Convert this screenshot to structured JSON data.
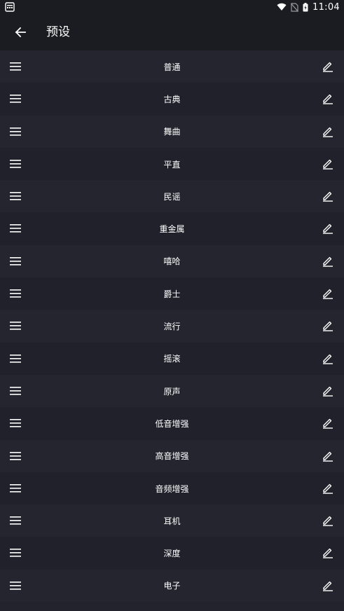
{
  "status_bar": {
    "time": "11:04",
    "icons": [
      "app-notification-icon",
      "wifi-icon",
      "no-sim-icon",
      "battery-charging-icon"
    ]
  },
  "app_bar": {
    "title": "预设",
    "back_icon": "arrow-back-icon"
  },
  "presets": [
    {
      "label": "普通"
    },
    {
      "label": "古典"
    },
    {
      "label": "舞曲"
    },
    {
      "label": "平直"
    },
    {
      "label": "民谣"
    },
    {
      "label": "重金属"
    },
    {
      "label": "嘻哈"
    },
    {
      "label": "爵士"
    },
    {
      "label": "流行"
    },
    {
      "label": "摇滚"
    },
    {
      "label": "原声"
    },
    {
      "label": "低音增强"
    },
    {
      "label": "高音增强"
    },
    {
      "label": "音频增强"
    },
    {
      "label": "耳机"
    },
    {
      "label": "深度"
    },
    {
      "label": "电子"
    }
  ],
  "row_icons": {
    "handle": "drag-handle-icon",
    "edit": "edit-icon"
  },
  "colors": {
    "background": "#22232c",
    "bar": "#1b1c21",
    "text": "#ffffff"
  }
}
